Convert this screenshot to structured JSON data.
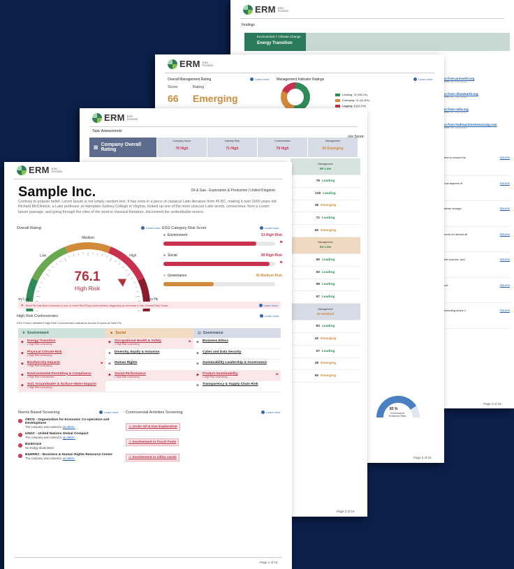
{
  "brand": {
    "name": "ERM",
    "sub1": "ESG",
    "sub2": "FUSION"
  },
  "colors": {
    "background": "#0b1f4a",
    "high": "#c9304d",
    "medium": "#d08a3a",
    "low": "#2e8b57",
    "env": "#2c7a5c",
    "gov": "#5d6b8c"
  },
  "learn_more": "Learn more",
  "page4": {
    "findings_label": "Findings",
    "banner_crumb": "Environment > Climate Change",
    "banner_title": "Energy Transition",
    "news": [
      {
        "link": "News from priceshil.org",
        "pub": "Published On: 12/07/2023"
      },
      {
        "link": "News from climatearth.org",
        "pub": "Published On: 12/07/2023"
      },
      {
        "link": "News from cells.org",
        "pub": "Published On: 12/07/2023"
      },
      {
        "link": "News from lindreactionresourcing.com",
        "pub": "Published On: 12/03/2023"
      }
    ],
    "right_rows": [
      {
        "text": "aims to reduce the",
        "src": "Source"
      },
      {
        "text": "rious aspects of",
        "src": "Source"
      },
      {
        "text": "carbon storage",
        "src": "Source"
      },
      {
        "text": "record for almost all",
        "src": "Source"
      },
      {
        "text": "able sources, and",
        "src": "Source"
      },
      {
        "text": "rted.",
        "src": "Source"
      },
      {
        "text": ", including scope 1",
        "src": "Source"
      }
    ],
    "page_no": "Page 4 of 16"
  },
  "page3": {
    "overall_mgmt": "Overall Management Rating",
    "mgmt_indicator": "Management Indicator Ratings",
    "score_hdr": "Score",
    "rating_hdr": "Rating",
    "score": "66",
    "rating": "Emerging",
    "donut_legend": [
      {
        "label": "Leading: 37 (58.1%)",
        "color": "#2e8b57"
      },
      {
        "label": "Emerging: 21 (31.8%)",
        "color": "#d08a3a"
      },
      {
        "label": "Lagging: 8 (12.1%)",
        "color": "#c9304d"
      }
    ],
    "gov_pct": "83 %",
    "gov_label": "Governance Evidence Rate",
    "page_no": "Page 3 of 16"
  },
  "page2": {
    "topic_assessments": "Topic Assessments",
    "gov_score": "nce Score: 51",
    "overall_row": {
      "name": "Company Overall Rating",
      "cells": [
        {
          "head": "Company Score",
          "value": "76 High",
          "cls": "c-high"
        },
        {
          "head": "Industry Risk",
          "value": "71 High",
          "cls": "c-high"
        },
        {
          "head": "Controversies",
          "value": "79 High",
          "cls": "c-high"
        },
        {
          "head": "Management",
          "value": "65 Emerging",
          "cls": "c-med"
        }
      ]
    },
    "mgmt_rows": [
      {
        "value": "69 Low",
        "cls": "c-low",
        "head": true,
        "tone": ""
      },
      {
        "n": "78",
        "value": "Leading",
        "cls": "c-low"
      },
      {
        "n": "100",
        "value": "Leading",
        "cls": "c-low"
      },
      {
        "n": "38",
        "value": "Emerging",
        "cls": "c-med"
      },
      {
        "n": "72",
        "value": "Leading",
        "cls": "c-low"
      },
      {
        "n": "50",
        "value": "Emerging",
        "cls": "c-med"
      },
      {
        "value": "53 Low",
        "cls": "c-low",
        "head": true,
        "tone": "orange"
      },
      {
        "n": "65",
        "value": "Leading",
        "cls": "c-low"
      },
      {
        "n": "50",
        "value": "Leading",
        "cls": "c-low"
      },
      {
        "n": "98",
        "value": "Leading",
        "cls": "c-low"
      },
      {
        "n": "67",
        "value": "Leading",
        "cls": "c-low"
      },
      {
        "value": "53 Medium",
        "cls": "c-med",
        "head": true,
        "tone": "blue"
      },
      {
        "n": "83",
        "value": "Leading",
        "cls": "c-low"
      },
      {
        "n": "40",
        "value": "Emerging",
        "cls": "c-med"
      },
      {
        "n": "67",
        "value": "Leading",
        "cls": "c-low"
      },
      {
        "n": "38",
        "value": "Emerging",
        "cls": "c-med"
      },
      {
        "n": "50",
        "value": "Emerging",
        "cls": "c-med"
      }
    ],
    "mgmt_head": "Management",
    "page_no": "Page 2 of 16"
  },
  "page1": {
    "company": "Sample Inc.",
    "sector": "Oil & Gas - Exploration & Production | United Kingdom",
    "description": "Contrary to popular belief, Lorem Ipsum is not simply random text. It has roots in a piece of classical Latin literature from 45 BC, making it over 2000 years old. Richard McClintock, a Latin professor at Hampden-Sydney College in Virginia, looked up one of the more obscure Latin words, consectetur, from a Lorem Ipsum passage, and going through the cites of the word in classical literature, discovered the undoubtable source.",
    "overall_rating": "Overall Rating",
    "esg_category": "ESG Category Risk Score",
    "score": "76.1",
    "score_label": "High Risk",
    "gauge_labels": [
      "Very Low",
      "Low",
      "Medium",
      "High",
      "Very High"
    ],
    "gauge_value": 76.1,
    "esg": [
      {
        "name": "Environment",
        "value": "51 High Risk",
        "pct": 0.83,
        "color": "#c9304d",
        "flag": true
      },
      {
        "name": "Social",
        "value": "89 High Risk",
        "pct": 0.95,
        "color": "#c9304d",
        "flag": true
      },
      {
        "name": "Governance",
        "value": "45 Medium Risk",
        "pct": 0.45,
        "color": "#d08a3a",
        "flag": false
      }
    ],
    "alert": "Shell Plc has been involved in one or more Red Flag controversies, triggering an increase in the Overall Risk Score.",
    "hrc_label": "High Risk Controversies",
    "hrc_intro": "ESG Fusion identified High Risk Controversies indicators across 8 topics at Shell Plc.",
    "grid_headers": [
      "Environment",
      "Social",
      "Governance"
    ],
    "grid": [
      [
        {
          "t": "Energy Transition",
          "s": "1 High Risk controversy",
          "hi": true,
          "fl": false
        },
        {
          "t": "Occupational Health & Safety",
          "s": "1 High Risk controversy",
          "hi": true,
          "fl": true
        },
        {
          "t": "Business Ethics",
          "s": "",
          "hi": false,
          "fl": false
        }
      ],
      [
        {
          "t": "Physical Climate Risk",
          "s": "1 High Risk controversy",
          "hi": true,
          "fl": false
        },
        {
          "t": "Diversity, Equity & Inclusion",
          "s": "",
          "hi": false,
          "fl": false
        },
        {
          "t": "Cyber and Data Security",
          "s": "",
          "hi": false,
          "fl": false
        }
      ],
      [
        {
          "t": "Biodiversity Impacts",
          "s": "1 High Risk controversy",
          "hi": true,
          "fl": true
        },
        {
          "t": "Human Rights",
          "s": "",
          "hi": false,
          "fl": false
        },
        {
          "t": "Sustainability Leadership & Governance",
          "s": "",
          "hi": false,
          "fl": false
        }
      ],
      [
        {
          "t": "Environmental Permitting & Compliance",
          "s": "2 High Risk controversies",
          "hi": true,
          "fl": false
        },
        {
          "t": "Social Performance",
          "s": "1 High Risk controversy",
          "hi": true,
          "fl": false
        },
        {
          "t": "Product Sustainability",
          "s": "1 High Risk controversy",
          "hi": true,
          "fl": true
        }
      ],
      [
        {
          "t": "Soil, Groundwater & Surface Water Impacts",
          "s": "1 High Risk controversy",
          "hi": true,
          "fl": false
        },
        {
          "t": "",
          "s": "",
          "hi": false,
          "fl": false
        },
        {
          "t": "Transparency & Supply Chain Risk",
          "s": "",
          "hi": false,
          "fl": false
        }
      ]
    ],
    "nbs_label": "Norms Based Screening",
    "cas_label": "Controversial Activities Screening",
    "norms": [
      {
        "t": "OECD - Organization for Economic Co-operation and Development",
        "s": "The company was named in",
        "link": "an article."
      },
      {
        "t": "UNGC - United Nations Global Compact",
        "s": "The company was named in",
        "link": "an article."
      },
      {
        "t": "Banktrack",
        "s": "No Dodgy deals listed",
        "link": ""
      },
      {
        "t": "B&HRRC - Business & Human Rights Resource Centre",
        "s": "The company was named in",
        "link": "an article."
      }
    ],
    "activities": [
      "Arctic Oil & Gas Exploration",
      "Involvement in Fossil Fuels",
      "Involvement in oil/tar sands"
    ],
    "page_no": "Page 1 of 16"
  }
}
